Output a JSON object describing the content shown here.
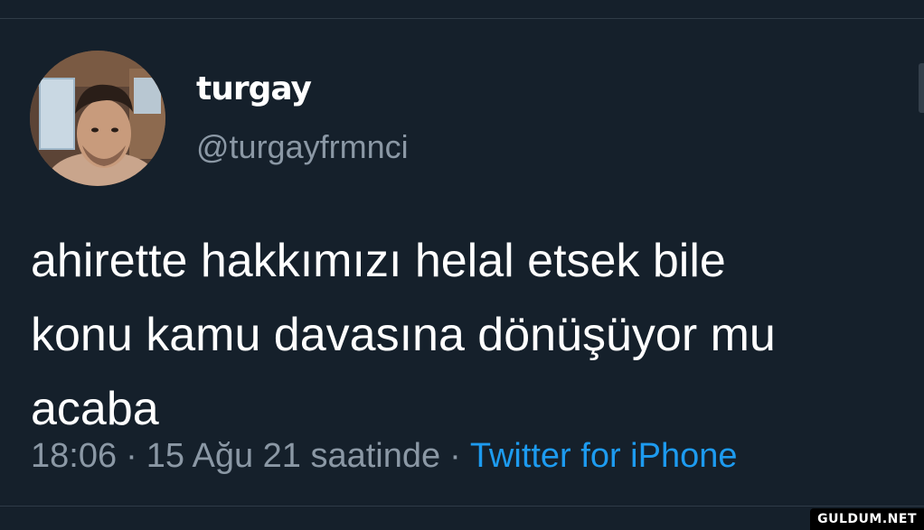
{
  "tweet": {
    "display_name": "turgay",
    "handle": "@turgayfrmnci",
    "text": "ahirette hakkımızı helal etsek bile\nkonu kamu davasına dönüşüyor mu\nacaba",
    "time": "18:06",
    "date": "15 Ağu 21 saatinde",
    "separator": "·",
    "source": "Twitter for iPhone"
  },
  "watermark": "GULDUM.NET",
  "colors": {
    "background": "#15202b",
    "text": "#ffffff",
    "muted": "#8b98a5",
    "link": "#1d9bf0"
  },
  "icons": {
    "avatar": "profile-photo"
  }
}
